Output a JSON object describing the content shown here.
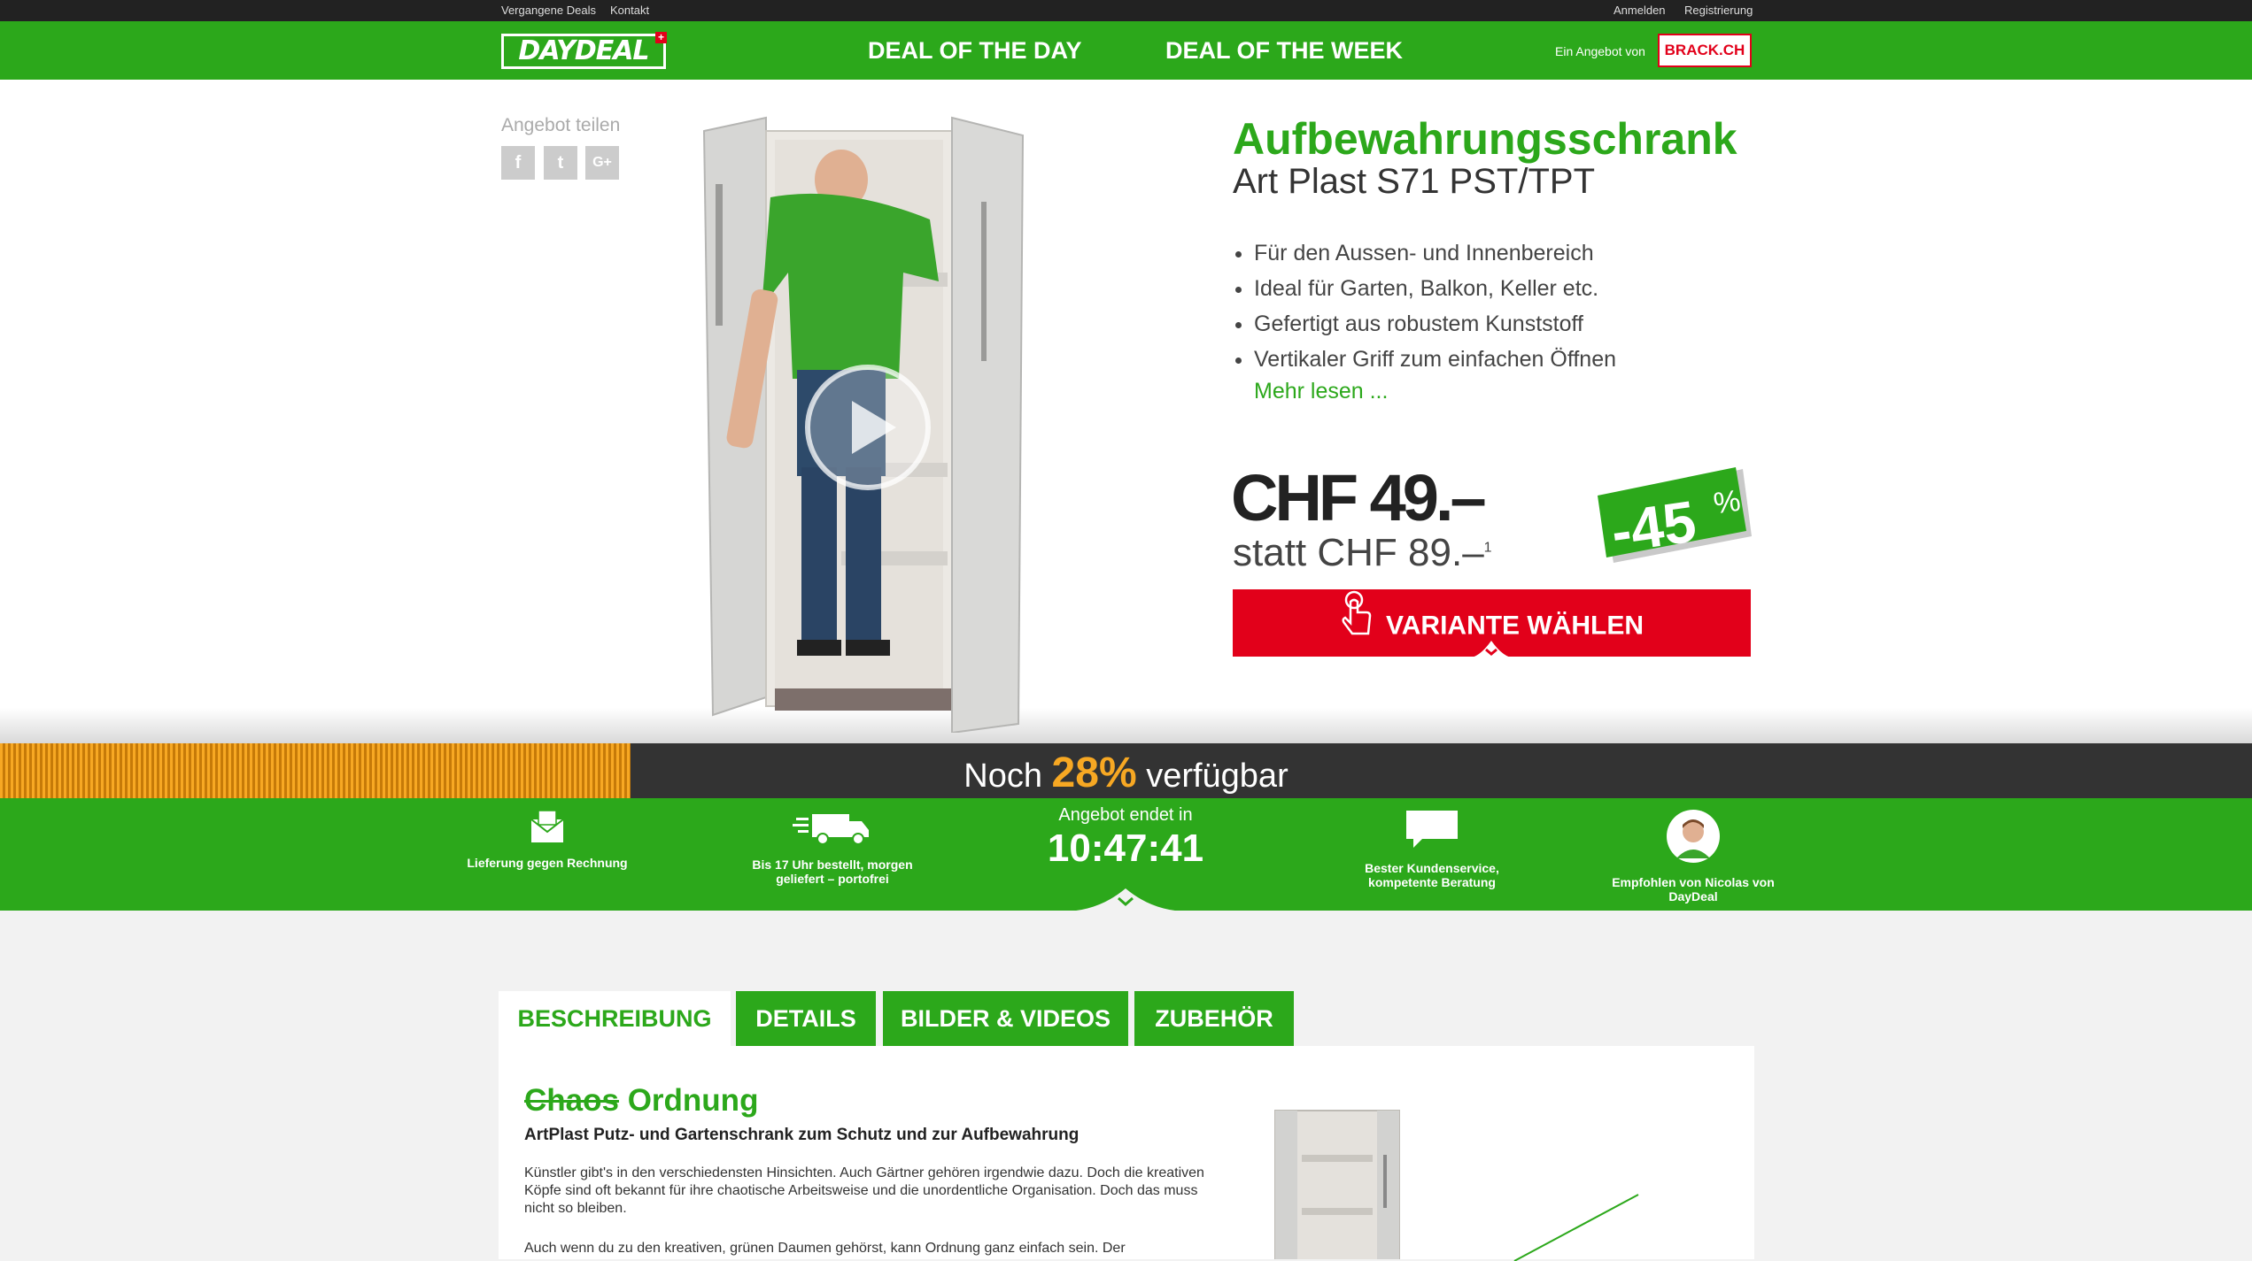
{
  "topbar": {
    "past_deals": "Vergangene Deals",
    "contact": "Kontakt",
    "login": "Anmelden",
    "register": "Registrierung"
  },
  "nav": {
    "logo": "DAYDEAL",
    "deal_day": "DEAL OF THE DAY",
    "deal_week": "DEAL OF THE WEEK",
    "offer_by": "Ein Angebot von",
    "partner": "BRACK.CH"
  },
  "share": {
    "label": "Angebot teilen",
    "facebook": "f",
    "twitter": "t",
    "google": "G+"
  },
  "product": {
    "title": "Aufbewahrungsschrank",
    "subtitle": "Art Plast S71 PST/TPT",
    "features": [
      "Für den Aussen- und Innenbereich",
      "Ideal für Garten, Balkon, Keller etc.",
      "Gefertigt aus robustem Kunststoff",
      "Vertikaler Griff zum einfachen Öffnen"
    ],
    "more": "Mehr lesen ...",
    "price": "CHF 49.–",
    "old_price": "statt CHF 89.–",
    "footnote": "1",
    "discount": "-45",
    "percent": "%",
    "cta": "VARIANTE WÄHLEN"
  },
  "availability": {
    "prefix": "Noch",
    "value": "28%",
    "suffix": "verfügbar",
    "fraction": 0.28
  },
  "info": {
    "invoice": "Lieferung gegen Rechnung",
    "delivery": "Bis 17 Uhr bestellt, morgen geliefert – portofrei",
    "ends_label": "Angebot endet in",
    "timer": "10:47:41",
    "service": "Bester Kundenservice, kompetente Beratung",
    "recommended": "Empfohlen von Nicolas von DayDeal"
  },
  "tabs": [
    "BESCHREIBUNG",
    "DETAILS",
    "BILDER & VIDEOS",
    "ZUBEHÖR"
  ],
  "description": {
    "strike": "Chaos",
    "heading": "Ordnung",
    "subheading": "ArtPlast Putz- und Gartenschrank zum Schutz und zur Aufbewahrung",
    "para1": "Künstler gibt's in den verschiedensten Hinsichten. Auch Gärtner gehören irgendwie dazu. Doch die kreativen Köpfe sind oft bekannt für ihre chaotische Arbeitsweise und die unordentliche Organisation. Doch das muss nicht so bleiben.",
    "para2": "Auch wenn du zu den kreativen, grünen Daumen gehörst, kann Ordnung ganz einfach sein. Der"
  },
  "colors": {
    "brand_green": "#2ca81b",
    "cta_red": "#e2001a",
    "orange": "#f7a823"
  }
}
